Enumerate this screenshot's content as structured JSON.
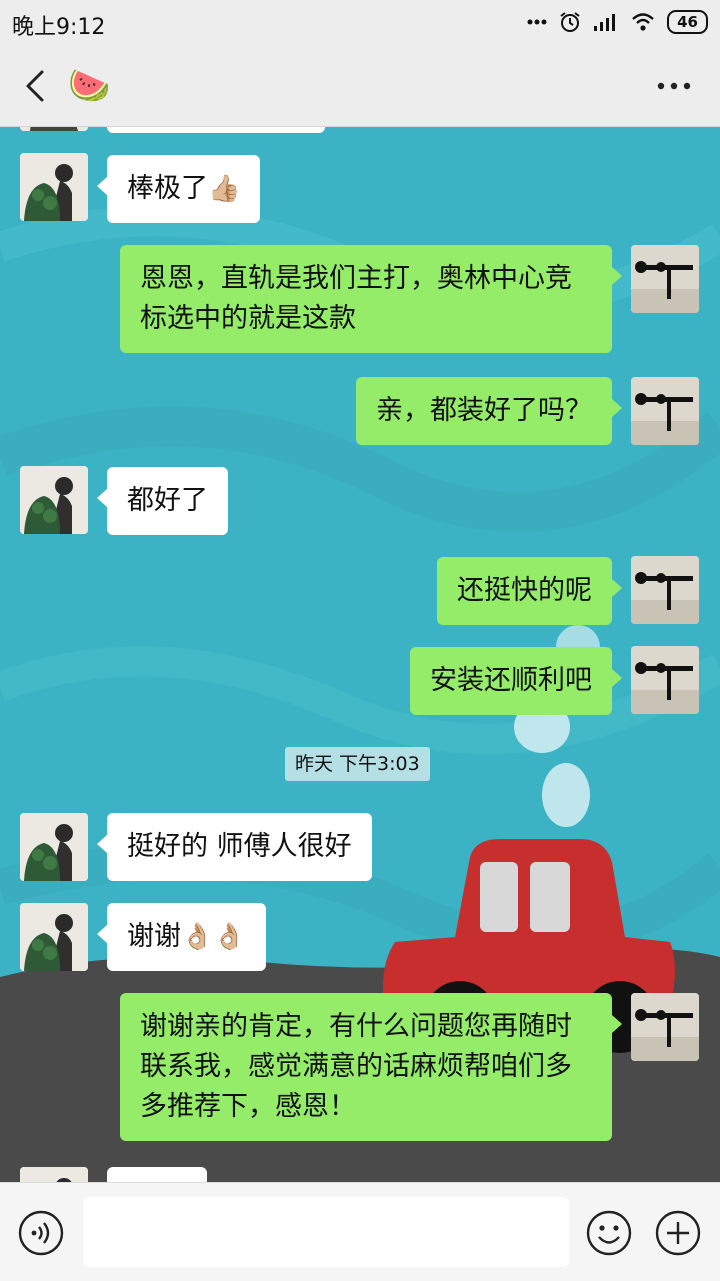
{
  "status_bar": {
    "time": "晚上9:12",
    "icons": [
      "dots-icon",
      "alarm-icon",
      "signal-icon",
      "wifi-icon",
      "battery-icon"
    ],
    "battery": "46"
  },
  "nav": {
    "title_emoji": "🍉",
    "back_icon": "chevron-left-icon",
    "more_icon": "more-dots-icon"
  },
  "timestamp": "昨天 下午3:03",
  "messages": [
    {
      "side": "left",
      "text": "棒极了",
      "emoji": "👍🏼"
    },
    {
      "side": "right",
      "text": "恩恩，直轨是我们主打，奥林中心竞标选中的就是这款"
    },
    {
      "side": "right",
      "text": "亲，都装好了吗？"
    },
    {
      "side": "left",
      "text": "都好了"
    },
    {
      "side": "right",
      "text": "还挺快的呢"
    },
    {
      "side": "right",
      "text": "安装还顺利吧"
    },
    {
      "side": "left",
      "text": "挺好的 师傅人很好"
    },
    {
      "side": "left",
      "text": "谢谢",
      "emoji": "👌🏼👌🏼"
    },
    {
      "side": "right",
      "text": "谢谢亲的肯定，有什么问题您再随时联系我，感觉满意的话麻烦帮咱们多多推荐下，感恩！"
    }
  ],
  "input": {
    "value": "",
    "placeholder": ""
  },
  "colors": {
    "bubble_sent": "#95ec69",
    "bubble_received": "#ffffff",
    "chat_background": "#3cb3c4"
  }
}
